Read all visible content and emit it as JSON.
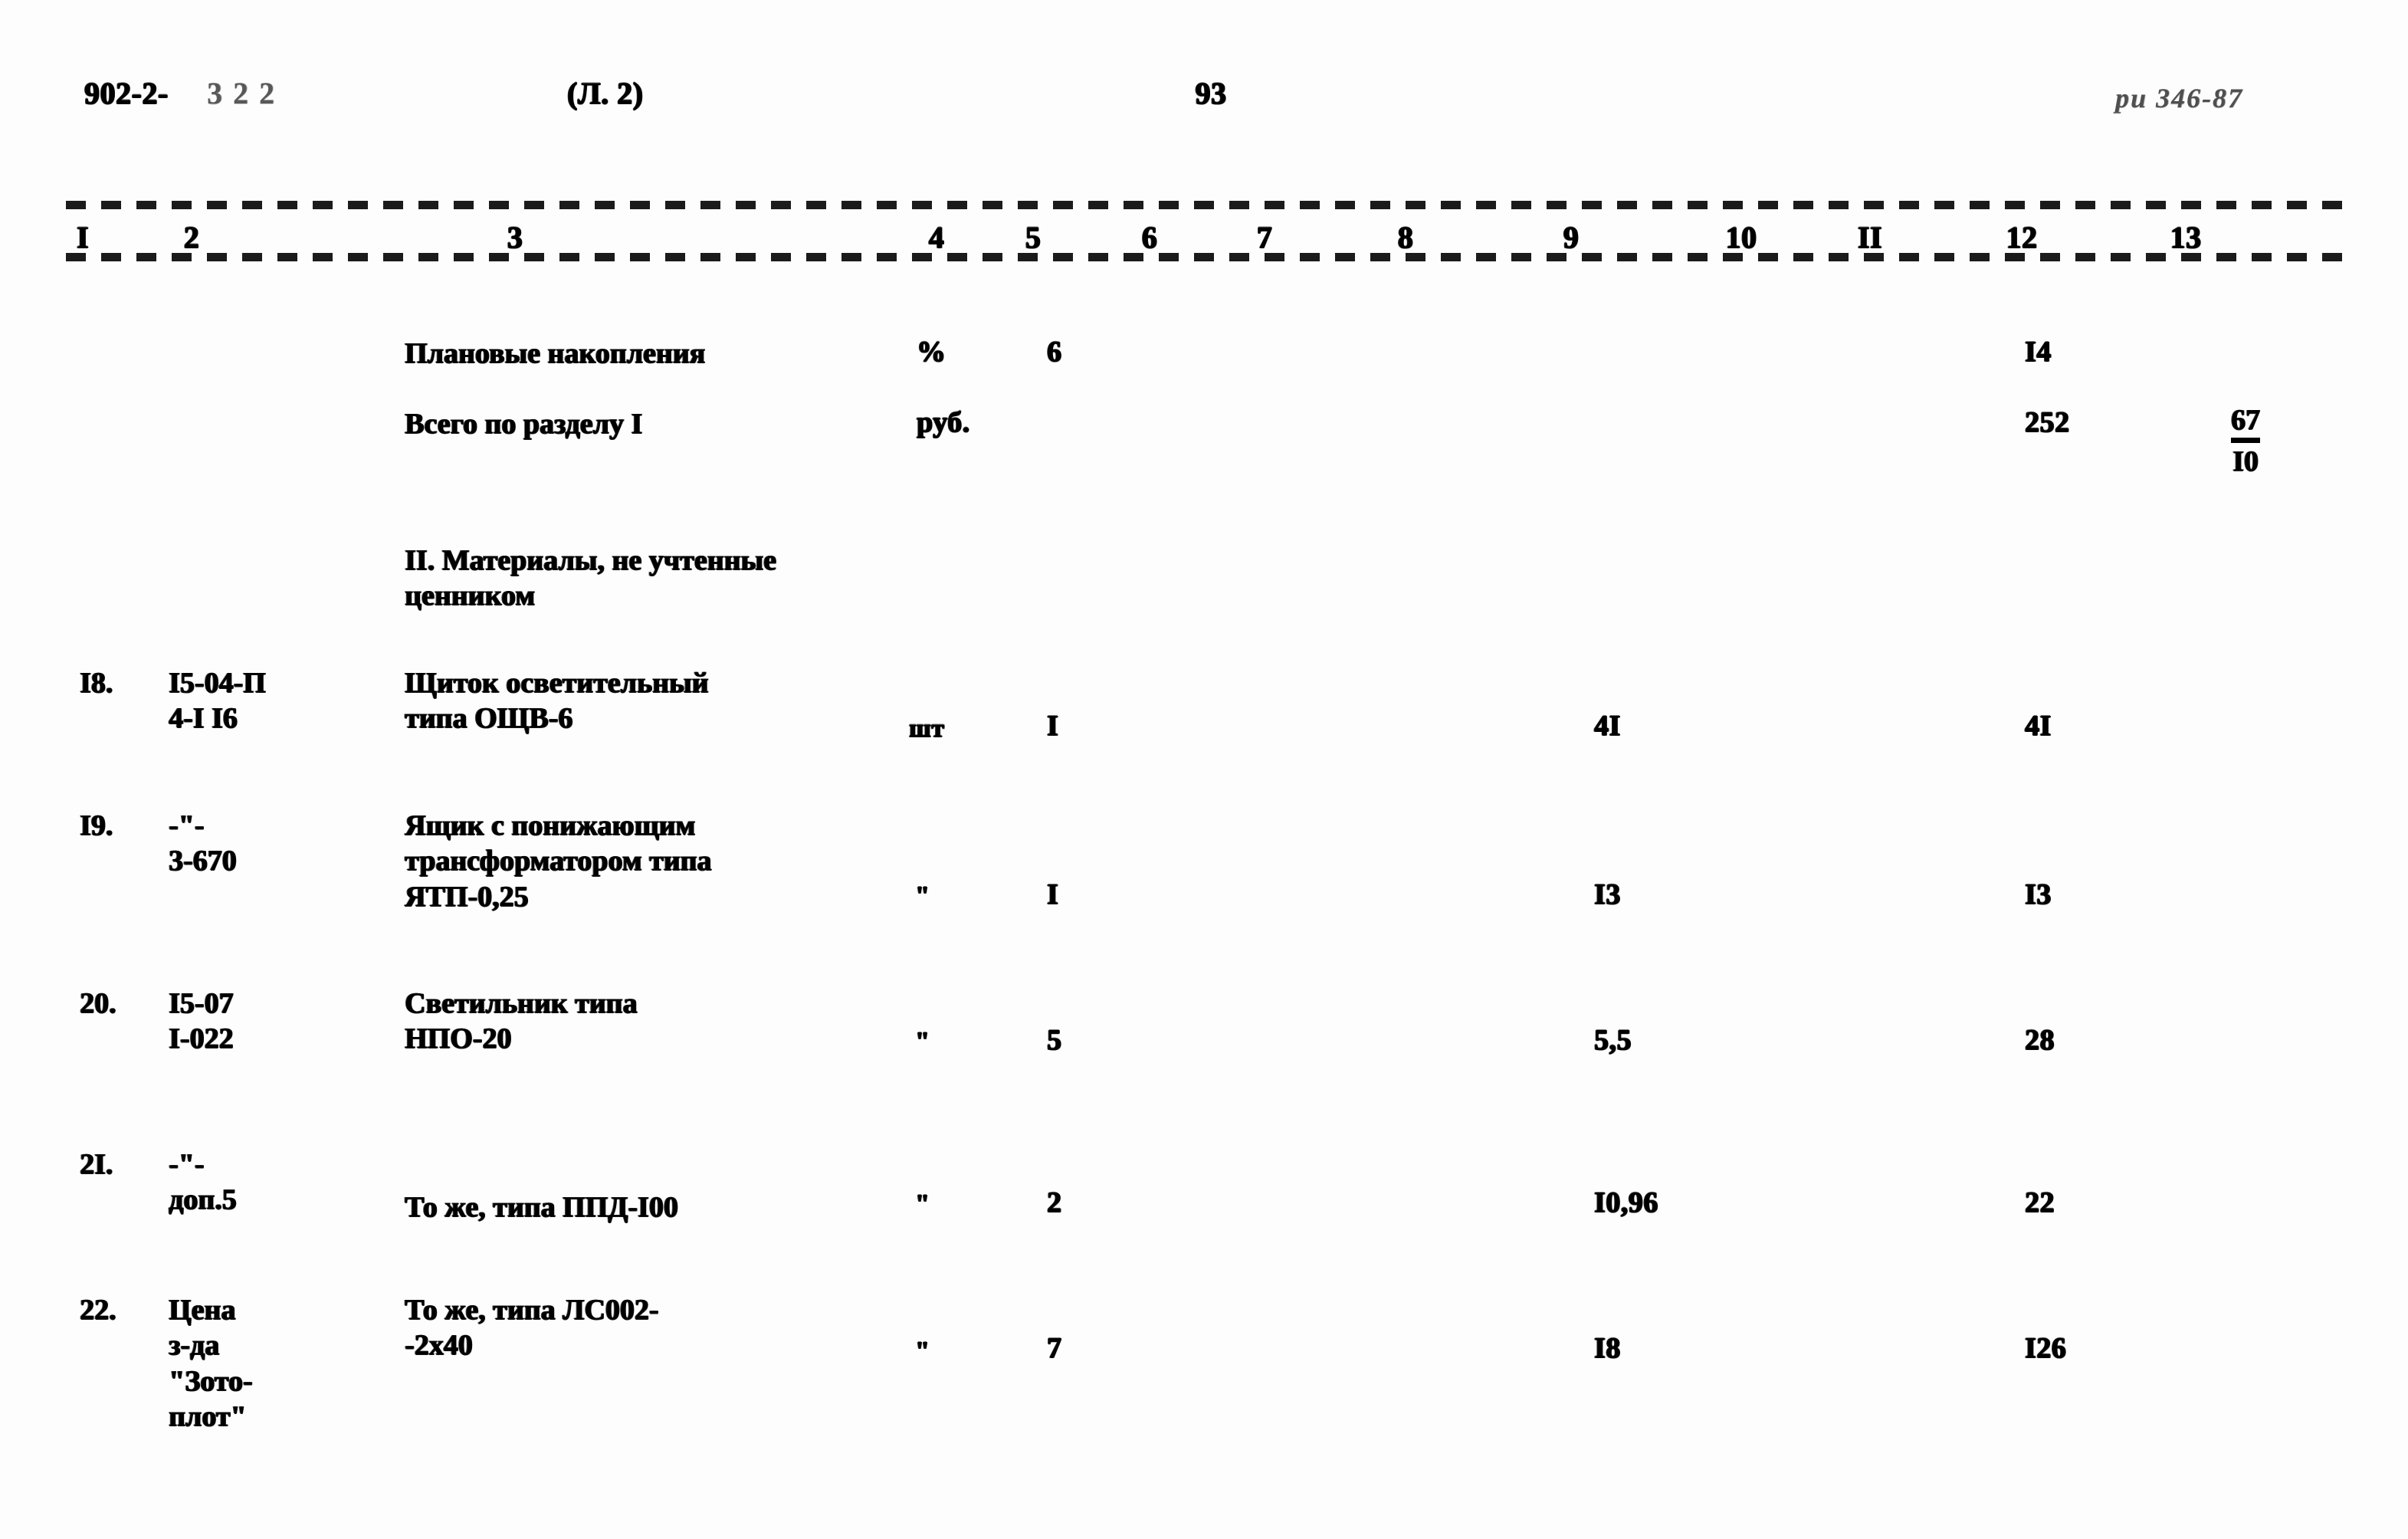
{
  "document": {
    "header": {
      "series_code": "902-2-",
      "series_suffix": "322",
      "sheet_label": "(Л. 2)",
      "page_number": "93",
      "stamp": "ри 346-87"
    },
    "column_numbers": [
      "I",
      "2",
      "3",
      "4",
      "5",
      "6",
      "7",
      "8",
      "9",
      "10",
      "II",
      "12",
      "13"
    ],
    "rows": [
      {
        "no": "",
        "code": "",
        "description": "Плановые накопления",
        "unit": "%",
        "qty": "6",
        "unit_price": "",
        "total": "I4",
        "extra": ""
      },
      {
        "no": "",
        "code": "",
        "description": "Всего по разделу I",
        "unit": "руб.",
        "qty": "",
        "unit_price": "",
        "total": "252",
        "extra_num": "67",
        "extra_den": "I0"
      },
      {
        "no": "",
        "code": "",
        "description": "II. Материалы, не учтенные\n      ценником",
        "unit": "",
        "qty": "",
        "unit_price": "",
        "total": "",
        "extra": ""
      },
      {
        "no": "I8.",
        "code": "I5-04-П\n4-I I6",
        "description": "Щиток осветительный\nтипа ОЩВ-6",
        "unit": "шт",
        "qty": "I",
        "unit_price": "4I",
        "total": "4I",
        "extra": ""
      },
      {
        "no": "I9.",
        "code": "-\"-\n3-670",
        "description": "Ящик с понижающим\nтрансформатором типа\nЯТП-0,25",
        "unit": "\"",
        "qty": "I",
        "unit_price": "I3",
        "total": "I3",
        "extra": ""
      },
      {
        "no": "20.",
        "code": "I5-07\nI-022",
        "description": "Светильник типа\nНПО-20",
        "unit": "\"",
        "qty": "5",
        "unit_price": "5,5",
        "total": "28",
        "extra": ""
      },
      {
        "no": "2I.",
        "code": "-\"-\nдоп.5",
        "description": "То же, типа ППД-I00",
        "unit": "\"",
        "qty": "2",
        "unit_price": "I0,96",
        "total": "22",
        "extra": ""
      },
      {
        "no": "22.",
        "code": "Цена\nз-да\n\"Зото-\nплот\"",
        "description": "То же, типа ЛС002-\n-2х40",
        "unit": "\"",
        "qty": "7",
        "unit_price": "I8",
        "total": "I26",
        "extra": ""
      }
    ]
  }
}
